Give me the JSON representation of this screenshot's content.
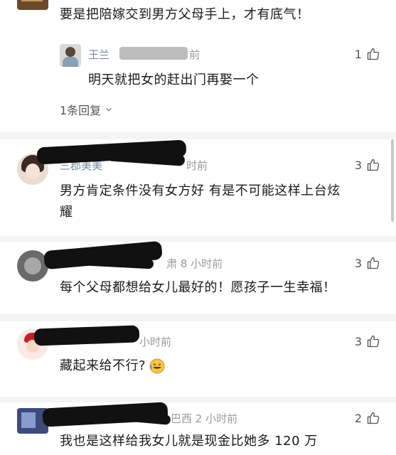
{
  "comment0": {
    "text": "要是把陪嫁交到男方父母手上，才有底气！"
  },
  "reply0": {
    "name": "王兰",
    "time": "前",
    "likes": "1",
    "text": "明天就把女的赶出门再娶一个"
  },
  "replies_toggle": {
    "label": "1条回复"
  },
  "comment1": {
    "name": "三郡美美",
    "time": "时前",
    "likes": "3",
    "text_line1": "男方肯定条件没有女方好 有是不可能这样上台炫",
    "text_line2": "耀"
  },
  "comment2": {
    "time": "肃 8 小时前",
    "likes": "3",
    "text": "每个父母都想给女儿最好的！愿孩子一生幸福！"
  },
  "comment3": {
    "time": "小时前",
    "likes": "3",
    "text": "藏起来给不行?"
  },
  "comment4": {
    "time": "巴西 2 小时前",
    "likes": "2",
    "text": "我也是这样给我女儿就是现金比她多 120 万"
  },
  "colors": {
    "background": "#f4f4f4",
    "card": "#ffffff",
    "meta": "#9a9a9a",
    "name": "#7a8aa0"
  }
}
